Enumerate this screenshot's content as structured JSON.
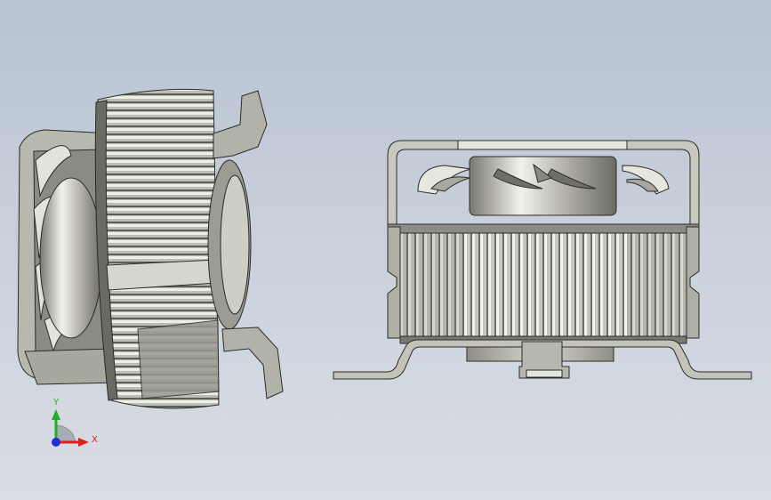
{
  "viewport": {
    "background_top": "#b7c2d2",
    "background_bottom": "#d9dde4"
  },
  "models": {
    "left_view": "isometric-fan-view",
    "right_view": "front-fan-view",
    "metal_color": "#b9b8ae",
    "edge_color": "#2b2b2b"
  },
  "triad": {
    "x_label": "X",
    "y_label": "Y",
    "x_color": "#e02020",
    "y_color": "#20b020",
    "z_color": "#2030d0"
  }
}
